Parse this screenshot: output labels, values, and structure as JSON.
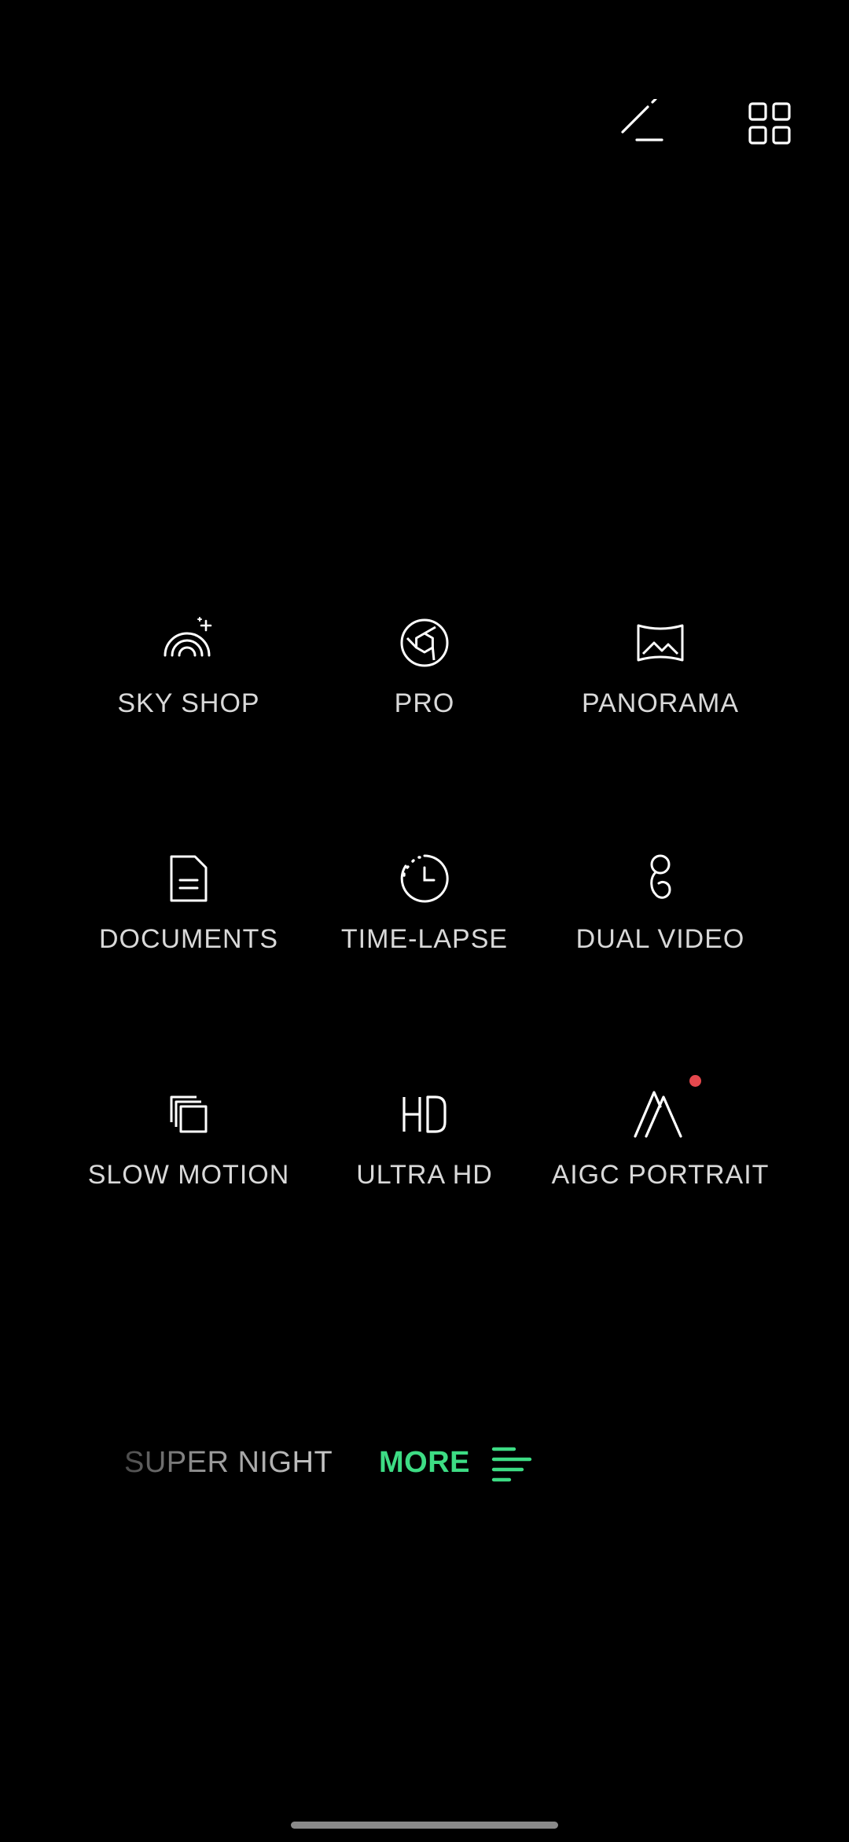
{
  "colors": {
    "background": "#000000",
    "accent": "#3ddc84",
    "label": "#d9d9d9",
    "notification_dot": "#e5484d"
  },
  "top_bar": {
    "edit_icon": "edit-pencil-icon",
    "grid_icon": "grid-view-icon"
  },
  "modes": [
    {
      "label": "SKY SHOP",
      "icon": "rainbow-sparkle-icon"
    },
    {
      "label": "PRO",
      "icon": "aperture-icon"
    },
    {
      "label": "PANORAMA",
      "icon": "panorama-icon"
    },
    {
      "label": "DOCUMENTS",
      "icon": "document-icon"
    },
    {
      "label": "TIME-LAPSE",
      "icon": "timer-icon"
    },
    {
      "label": "DUAL VIDEO",
      "icon": "dual-video-icon"
    },
    {
      "label": "SLOW MOTION",
      "icon": "stacked-frames-icon"
    },
    {
      "label": "ULTRA HD",
      "icon": "hd-icon"
    },
    {
      "label": "AIGC PORTRAIT",
      "icon": "aigc-portrait-icon",
      "badge": "new-dot"
    }
  ],
  "mode_bar": {
    "previous_mode": "SUPER NIGHT",
    "current_mode": "MORE",
    "current_icon": "more-menu-icon"
  }
}
